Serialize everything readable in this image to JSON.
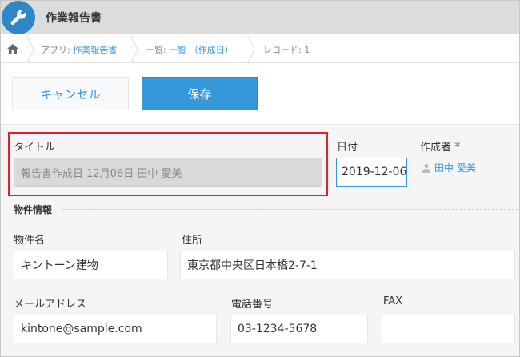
{
  "app": {
    "title": "作業報告書",
    "icon": "wrench-icon",
    "accent_color": "#3498db"
  },
  "breadcrumb": {
    "home_icon": "home-icon",
    "app_prefix": "アプリ: ",
    "app_name": "作業報告書",
    "list_prefix": "一覧: ",
    "list_name": "一覧 （作成日）",
    "record": "レコード: 1"
  },
  "toolbar": {
    "cancel_label": "キャンセル",
    "save_label": "保存"
  },
  "form": {
    "title": {
      "label": "タイトル",
      "value": "報告書作成日 12月06日 田中 愛美"
    },
    "date": {
      "label": "日付",
      "value": "2019-12-06"
    },
    "creator": {
      "label": "作成者",
      "required_mark": "*",
      "user": "田中 愛美"
    },
    "group_label": "物件情報",
    "property_name": {
      "label": "物件名",
      "value": "キントーン建物"
    },
    "address": {
      "label": "住所",
      "value": "東京都中央区日本橋2-7-1"
    },
    "email": {
      "label": "メールアドレス",
      "value": "kintone@sample.com"
    },
    "phone": {
      "label": "電話番号",
      "value": "03-1234-5678"
    },
    "fax": {
      "label": "FAX",
      "value": ""
    }
  }
}
